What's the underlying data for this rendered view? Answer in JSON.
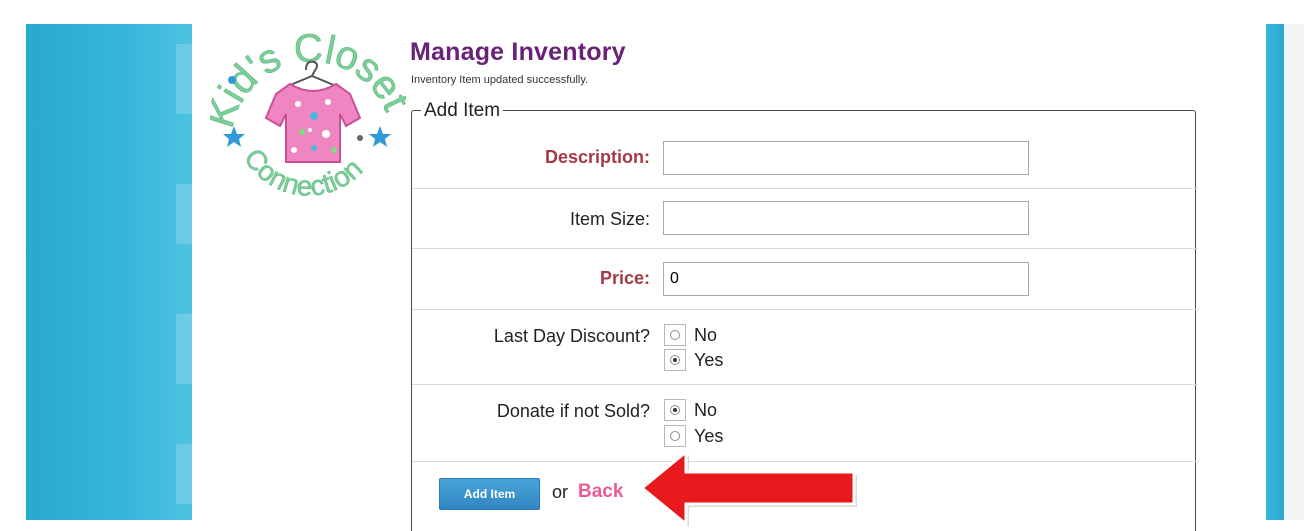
{
  "page": {
    "title": "Manage Inventory",
    "flash_message": "Inventory Item updated successfully."
  },
  "logo": {
    "top_text": "Kid's Closet",
    "bottom_text": "Connection"
  },
  "form": {
    "legend": "Add Item",
    "description": {
      "label": "Description:",
      "value": ""
    },
    "item_size": {
      "label": "Item Size:",
      "value": ""
    },
    "price": {
      "label": "Price:",
      "value": "0"
    },
    "last_day_discount": {
      "label": "Last Day Discount?",
      "options": [
        "No",
        "Yes"
      ],
      "selected": "Yes"
    },
    "donate_if_not_sold": {
      "label": "Donate if not Sold?",
      "options": [
        "No",
        "Yes"
      ],
      "selected": "No"
    },
    "submit_label": "Add Item",
    "or_text": "or",
    "back_label": "Back"
  },
  "colors": {
    "title": "#6a2178",
    "required_label": "#a53a44",
    "back_link": "#ea5b92",
    "button": "#2f86c2",
    "arrow": "#e8191c",
    "teal": "#2aa9cf"
  },
  "icons": {
    "logo_shirt": "shirt-icon",
    "logo_star": "star-icon",
    "annotation": "arrow-left-icon"
  }
}
